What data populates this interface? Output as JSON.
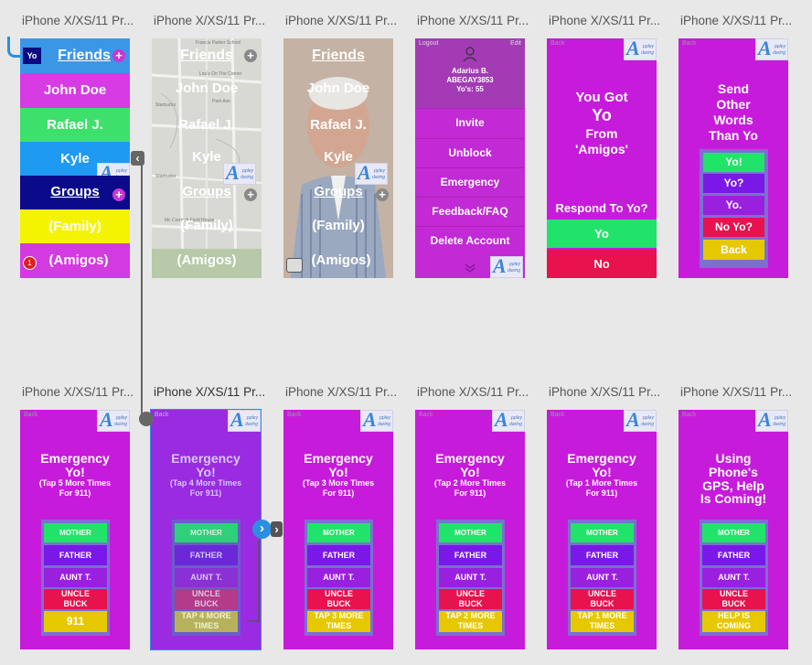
{
  "artboard_titles": {
    "top": [
      "iPhone X/XS/11 Pr...",
      "iPhone X/XS/11 Pr...",
      "iPhone X/XS/11 Pr...",
      "iPhone X/XS/11 Pr...",
      "iPhone X/XS/11 Pr...",
      "iPhone X/XS/11 Pr..."
    ],
    "bottom": [
      "iPhone X/XS/11 Pr...",
      "iPhone X/XS/11 Pr...",
      "iPhone X/XS/11 Pr...",
      "iPhone X/XS/11 Pr...",
      "iPhone X/XS/11 Pr...",
      "iPhone X/XS/11 Pr..."
    ]
  },
  "logo": {
    "letter": "A",
    "line1": "ppley",
    "line2": "daring"
  },
  "friends_screen": {
    "yo_badge": "Yo",
    "friends_label": "Friends",
    "plus": "+",
    "friends": [
      "John Doe",
      "Rafael J.",
      "Kyle"
    ],
    "groups_label": "Groups",
    "groups": [
      "(Family)",
      "(Amigos)"
    ],
    "notif_count": "1",
    "colors": {
      "header": "#3c96e6",
      "john": "#d63be4",
      "rafael": "#3ce06a",
      "kyle": "#1e9af2",
      "groups": "#0a0a8a",
      "family": "#f4f400",
      "amigos": "#d23be0"
    }
  },
  "map_labels": [
    "Francis Parker School",
    "Lou's On The Corner",
    "Starbucks",
    "Starbucks",
    "Mc Cormick Field House",
    "Park Ave"
  ],
  "menu_screen": {
    "logout": "Logout",
    "edit": "Edit",
    "name": "Adarius B.",
    "handle": "ABEGAY3853",
    "yos": "Yo's: 55",
    "items": [
      "Invite",
      "Unblock",
      "Emergency",
      "Feedback/FAQ",
      "Delete Account"
    ]
  },
  "got_yo_screen": {
    "back": "Back",
    "line1": "You Got",
    "line2": "Yo",
    "line3": "From",
    "line4": "'Amigos'",
    "question": "Respond To Yo?",
    "yes": "Yo",
    "no": "No"
  },
  "send_other_screen": {
    "back": "Back",
    "title": [
      "Send",
      "Other",
      "Words",
      "Than Yo"
    ],
    "options": [
      "Yo!",
      "Yo?",
      "Yo.",
      "No Yo?",
      "Back"
    ]
  },
  "emergency_screens": [
    {
      "back": "Back",
      "title1": "Emergency",
      "title2": "Yo!",
      "sub": "(Tap 5 More Times For 911)",
      "last": "911"
    },
    {
      "back": "Back",
      "title1": "Emergency",
      "title2": "Yo!",
      "sub": "(Tap 4 More Times For 911)",
      "last": "TAP 4 MORE TIMES"
    },
    {
      "back": "Back",
      "title1": "Emergency",
      "title2": "Yo!",
      "sub": "(Tap 3 More Times For 911)",
      "last": "TAP 3 MORE TIMES"
    },
    {
      "back": "Back",
      "title1": "Emergency",
      "title2": "Yo!",
      "sub": "(Tap 2 More Times For 911)",
      "last": "TAP 2 MORE TIMES"
    },
    {
      "back": "Back",
      "title1": "Emergency",
      "title2": "Yo!",
      "sub": "(Tap 1 More Times For 911)",
      "last": "TAP 1 MORE TIMES"
    }
  ],
  "gps_screen": {
    "back": "Back",
    "title": [
      "Using",
      "Phone's",
      "GPS, Help",
      "Is Coming!"
    ],
    "last": "HELP IS COMING"
  },
  "contacts": [
    "MOTHER",
    "FATHER",
    "AUNT T.",
    "UNCLE BUCK"
  ]
}
